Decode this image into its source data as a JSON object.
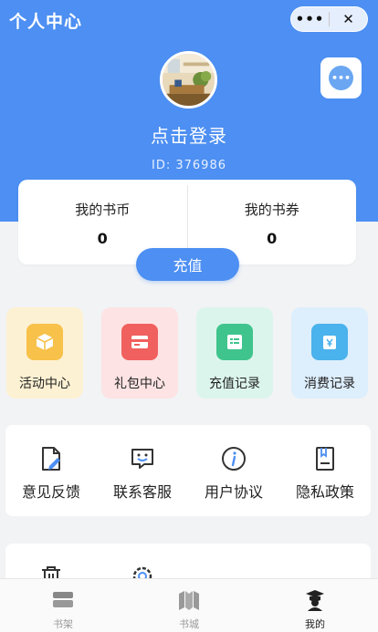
{
  "header": {
    "title": "个人中心",
    "capsule_more": "•••",
    "capsule_close": "✕"
  },
  "profile": {
    "login_text": "点击登录",
    "user_id": "ID: 376986",
    "message_icon": "chat-bubble-icon"
  },
  "wallet": {
    "coins_label": "我的书币",
    "coins_value": "0",
    "vouchers_label": "我的书券",
    "vouchers_value": "0",
    "recharge_label": "充值"
  },
  "tiles": [
    {
      "label": "活动中心",
      "icon": "box-icon",
      "bg": "#fdf1d3",
      "icon_bg": "#f7c14a"
    },
    {
      "label": "礼包中心",
      "icon": "card-icon",
      "bg": "#fde3e3",
      "icon_bg": "#f0605e"
    },
    {
      "label": "充值记录",
      "icon": "list-icon",
      "bg": "#dcf5ec",
      "icon_bg": "#3fc48d"
    },
    {
      "label": "消费记录",
      "icon": "bag-icon",
      "bg": "#ddeefc",
      "icon_bg": "#4ab2ec"
    }
  ],
  "services": [
    {
      "label": "意见反馈",
      "icon": "feedback-icon"
    },
    {
      "label": "联系客服",
      "icon": "customer-service-icon"
    },
    {
      "label": "用户协议",
      "icon": "info-icon"
    },
    {
      "label": "隐私政策",
      "icon": "privacy-book-icon"
    }
  ],
  "services_row2": [
    {
      "icon": "trash-icon"
    },
    {
      "icon": "settings-icon"
    }
  ],
  "tabbar": {
    "shelf": "书架",
    "store": "书城",
    "mine": "我的"
  },
  "colors": {
    "primary": "#4d8ff2",
    "background": "#f2f3f5"
  }
}
